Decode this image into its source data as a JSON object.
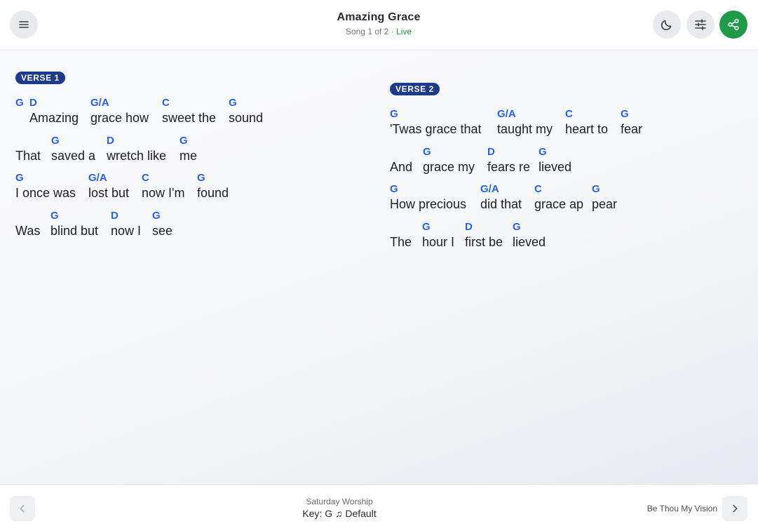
{
  "header": {
    "title": "Amazing Grace",
    "position": "Song 1 of 2",
    "live_label": "· Live",
    "icons": [
      "menu-icon",
      "moon-icon",
      "sliders-icon",
      "share-icon"
    ],
    "share_color": "#1f9a48"
  },
  "sections": [
    {
      "label": "VERSE 1",
      "lines": [
        [
          {
            "chord": "G",
            "lyric": ""
          },
          {
            "chord": "D",
            "lyric": "Amazing"
          },
          {
            "chord": "G/A",
            "lyric": "grace how"
          },
          {
            "chord": "C",
            "lyric": "sweet the"
          },
          {
            "chord": "G",
            "lyric": "sound"
          }
        ],
        [
          {
            "chord": "",
            "lyric": "That"
          },
          {
            "chord": "G",
            "lyric": "saved a"
          },
          {
            "chord": "D",
            "lyric": "wretch like"
          },
          {
            "chord": "G",
            "lyric": "me"
          }
        ],
        [
          {
            "chord": "G",
            "lyric": "I once was"
          },
          {
            "chord": "G/A",
            "lyric": "lost but"
          },
          {
            "chord": "C",
            "lyric": "now I'm"
          },
          {
            "chord": "G",
            "lyric": "found"
          }
        ],
        [
          {
            "chord": "",
            "lyric": "Was"
          },
          {
            "chord": "G",
            "lyric": "blind but"
          },
          {
            "chord": "D",
            "lyric": "now I"
          },
          {
            "chord": "G",
            "lyric": "see"
          }
        ]
      ]
    },
    {
      "label": "VERSE 2",
      "lines": [
        [
          {
            "chord": "G",
            "lyric": "'Twas grace that"
          },
          {
            "chord": "G/A",
            "lyric": "taught my"
          },
          {
            "chord": "C",
            "lyric": "heart to"
          },
          {
            "chord": "G",
            "lyric": "fear"
          }
        ],
        [
          {
            "chord": "",
            "lyric": "And"
          },
          {
            "chord": "G",
            "lyric": "grace my"
          },
          {
            "chord": "D",
            "lyric": "fears re"
          },
          {
            "chord": "G",
            "lyric": "lieved"
          }
        ],
        [
          {
            "chord": "G",
            "lyric": "How precious"
          },
          {
            "chord": "G/A",
            "lyric": "did that"
          },
          {
            "chord": "C",
            "lyric": "grace ap"
          },
          {
            "chord": "G",
            "lyric": "pear"
          }
        ],
        [
          {
            "chord": "",
            "lyric": "The"
          },
          {
            "chord": "G",
            "lyric": "hour I"
          },
          {
            "chord": "D",
            "lyric": "first be"
          },
          {
            "chord": "G",
            "lyric": "lieved"
          }
        ]
      ]
    }
  ],
  "footer": {
    "set_name": "Saturday Worship",
    "key_prefix": "Key:",
    "key_value": "G",
    "key_icon": "♫",
    "arrangement": "Default",
    "next_song": "Be Thou My Vision",
    "icons": [
      "chevron-left-icon",
      "chevron-right-icon"
    ]
  },
  "colors": {
    "chord": "#2563eb",
    "badge": "#1e3a8a",
    "live": "#1f9a48"
  }
}
